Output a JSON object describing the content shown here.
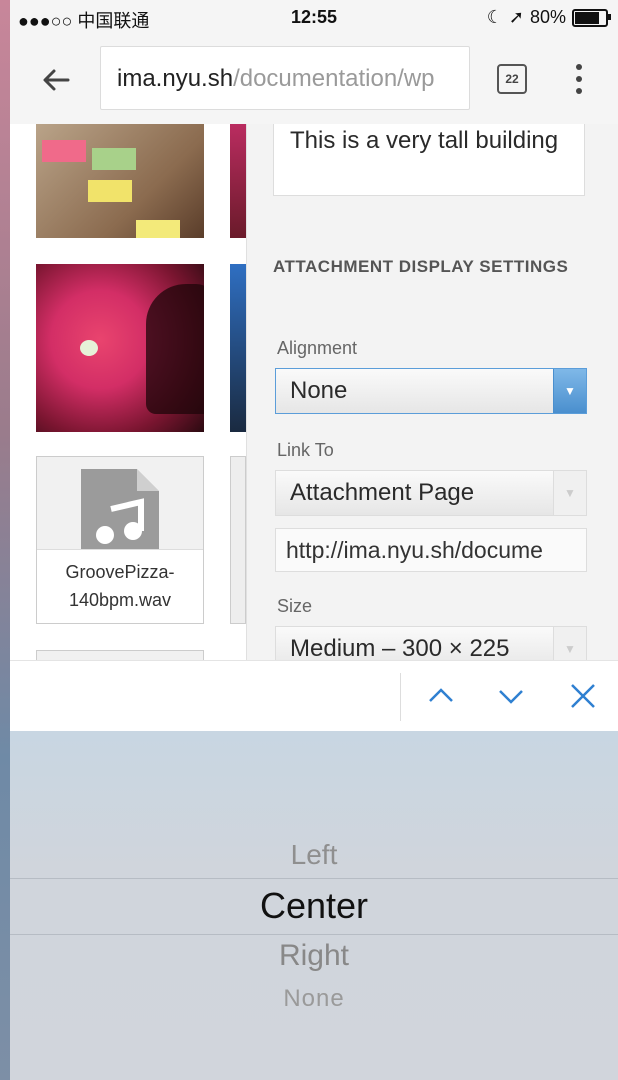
{
  "status_bar": {
    "carrier": "●●●○○ 中国联通",
    "time": "12:55",
    "battery": "80%",
    "battery_level": 0.8
  },
  "browser": {
    "url_host": "ima.nyu.sh",
    "url_path": "/documentation/wp",
    "tab_count": "22"
  },
  "media_grid": {
    "file_name": "GroovePizza-140bpm.wav"
  },
  "details_panel": {
    "caption_text": "This is a very tall building",
    "section_title": "ATTACHMENT DISPLAY SETTINGS",
    "alignment_label": "Alignment",
    "alignment_value": "None",
    "link_to_label": "Link To",
    "link_to_value": "Attachment Page",
    "link_url": "http://ima.nyu.sh/docume",
    "size_label": "Size",
    "size_value": "Medium – 300 × 225"
  },
  "picker": {
    "options": [
      "Left",
      "Center",
      "Right",
      "None"
    ],
    "selected": "Center"
  },
  "colors": {
    "accent": "#2f80d1",
    "active_select": "#5b9dd9"
  }
}
